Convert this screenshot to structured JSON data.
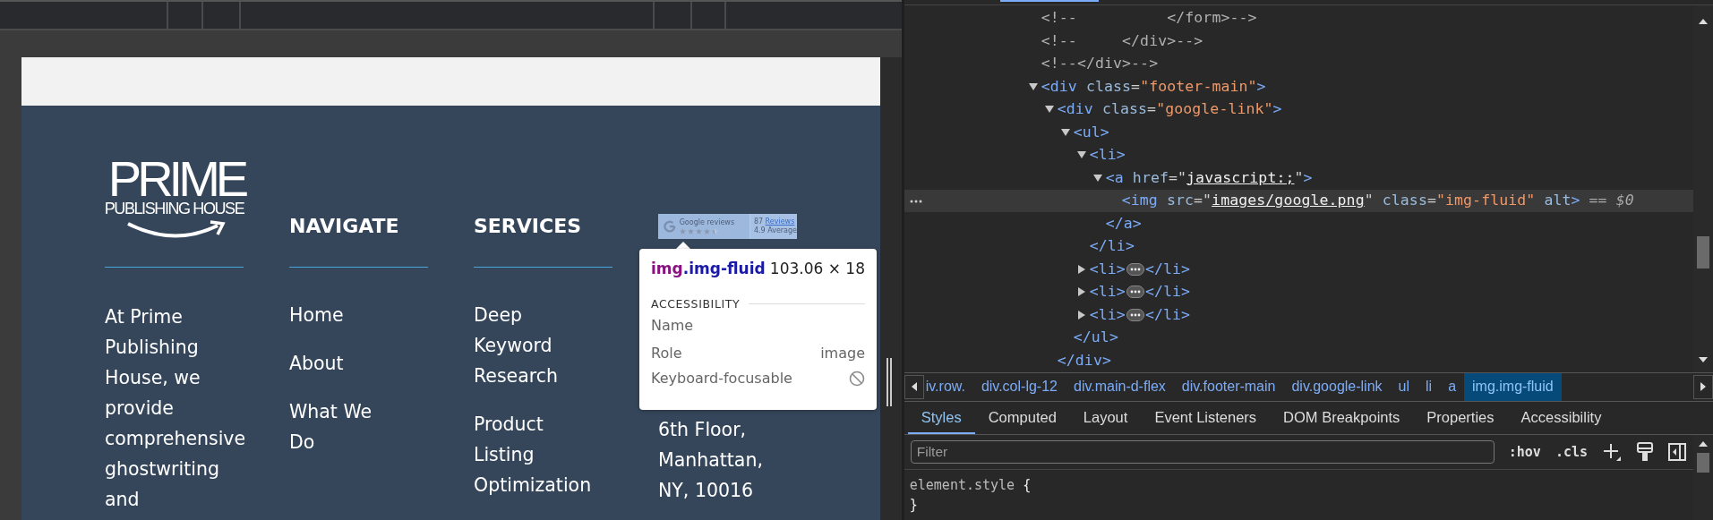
{
  "page": {
    "logo": {
      "title": "PRIME",
      "subtitle": "PUBLISHING HOUSE"
    },
    "about": {
      "lines": [
        "At Prime",
        "Publishing",
        "House, we",
        "provide",
        "comprehensive",
        "ghostwriting",
        "and"
      ]
    },
    "navigate": {
      "heading": "NAVIGATE",
      "links": [
        {
          "lines": [
            "Home"
          ]
        },
        {
          "lines": [
            "About"
          ]
        },
        {
          "lines": [
            "What We",
            "Do"
          ]
        }
      ]
    },
    "services": {
      "heading": "SERVICES",
      "links": [
        {
          "lines": [
            "Deep",
            "Keyword",
            "Research"
          ]
        },
        {
          "lines": [
            "Product",
            "Listing",
            "Optimization"
          ]
        }
      ]
    },
    "reviews_badge": {
      "label": "Google reviews",
      "stars": 4.5,
      "count": "87",
      "count_label": "Reviews",
      "rating": "4.9",
      "rating_label": "Average"
    },
    "address": {
      "lines": [
        "6th Floor,",
        "Manhattan,",
        "NY, 10016"
      ]
    },
    "tooltip": {
      "tag": "img",
      "class": ".img-fluid",
      "size": "103.06 × 18",
      "section": "ACCESSIBILITY",
      "rows": [
        {
          "label": "Name",
          "kind": "text"
        },
        {
          "label": "Role",
          "kind": "text",
          "value": "image"
        },
        {
          "label": "Keyboard-focusable",
          "kind": "blocked"
        }
      ]
    }
  },
  "tree": {
    "nodes": [
      {
        "selected": false,
        "open": [
          {
            "text": "<!--          </form>-->",
            "kind": "comment"
          }
        ]
      },
      {
        "selected": false,
        "open": [
          {
            "text": "<!--     </div>-->",
            "kind": "comment"
          }
        ]
      },
      {
        "selected": false,
        "open": [
          {
            "text": "<!--</div>-->",
            "kind": "comment"
          }
        ]
      },
      {
        "selected": false,
        "expanded": true,
        "open": [
          {
            "text": "<div",
            "kind": "tag"
          },
          {
            "text": " class",
            "kind": "attr"
          },
          {
            "text": "=",
            "kind": "punct"
          },
          {
            "text": "\"footer-main\"",
            "kind": "value"
          },
          {
            "text": ">",
            "kind": "tag"
          }
        ],
        "children": [
          {
            "selected": false,
            "expanded": true,
            "open": [
              {
                "text": "<div",
                "kind": "tag"
              },
              {
                "text": " class",
                "kind": "attr"
              },
              {
                "text": "=",
                "kind": "punct"
              },
              {
                "text": "\"google-link\"",
                "kind": "value"
              },
              {
                "text": ">",
                "kind": "tag"
              }
            ],
            "close": [
              {
                "text": "</div>",
                "kind": "tag"
              }
            ],
            "children": [
              {
                "selected": false,
                "expanded": true,
                "open": [
                  {
                    "text": "<ul>",
                    "kind": "tag"
                  }
                ],
                "close": [
                  {
                    "text": "</ul>",
                    "kind": "tag"
                  }
                ],
                "children": [
                  {
                    "selected": false,
                    "expanded": true,
                    "open": [
                      {
                        "text": "<li>",
                        "kind": "tag"
                      }
                    ],
                    "close": [
                      {
                        "text": "</li>",
                        "kind": "tag"
                      }
                    ],
                    "children": [
                      {
                        "selected": false,
                        "expanded": true,
                        "open": [
                          {
                            "text": "<a",
                            "kind": "tag"
                          },
                          {
                            "text": " href",
                            "kind": "attr"
                          },
                          {
                            "text": "=\"",
                            "kind": "punct"
                          },
                          {
                            "text": "javascript:;",
                            "kind": "link"
                          },
                          {
                            "text": "\"",
                            "kind": "punct"
                          },
                          {
                            "text": ">",
                            "kind": "tag"
                          }
                        ],
                        "close": [
                          {
                            "text": "</a>",
                            "kind": "tag"
                          }
                        ],
                        "children": [
                          {
                            "selected": true,
                            "open": [
                              {
                                "text": "<img",
                                "kind": "tag"
                              },
                              {
                                "text": " src",
                                "kind": "attr"
                              },
                              {
                                "text": "=\"",
                                "kind": "punct"
                              },
                              {
                                "text": "images/google.png",
                                "kind": "link"
                              },
                              {
                                "text": "\"",
                                "kind": "punct"
                              },
                              {
                                "text": " class",
                                "kind": "attr"
                              },
                              {
                                "text": "=",
                                "kind": "punct"
                              },
                              {
                                "text": "\"img-fluid\"",
                                "kind": "value"
                              },
                              {
                                "text": " alt",
                                "kind": "attr"
                              },
                              {
                                "text": ">",
                                "kind": "tag"
                              },
                              {
                                "text": " == ",
                                "kind": "ref"
                              },
                              {
                                "text": "$0",
                                "kind": "refvar"
                              }
                            ]
                          }
                        ]
                      }
                    ]
                  },
                  {
                    "selected": false,
                    "expanded": false,
                    "open": [
                      {
                        "text": "<li>",
                        "kind": "tag"
                      }
                    ],
                    "close": [
                      {
                        "text": "</li>",
                        "kind": "tag"
                      }
                    ]
                  },
                  {
                    "selected": false,
                    "expanded": false,
                    "open": [
                      {
                        "text": "<li>",
                        "kind": "tag"
                      }
                    ],
                    "close": [
                      {
                        "text": "</li>",
                        "kind": "tag"
                      }
                    ]
                  },
                  {
                    "selected": false,
                    "expanded": false,
                    "open": [
                      {
                        "text": "<li>",
                        "kind": "tag"
                      }
                    ],
                    "close": [
                      {
                        "text": "</li>",
                        "kind": "tag"
                      }
                    ]
                  }
                ]
              }
            ]
          }
        ]
      }
    ]
  },
  "breadcrumbs": [
    {
      "label": "iv.row.",
      "selected": false
    },
    {
      "label": "div.col-lg-12",
      "selected": false
    },
    {
      "label": "div.main-d-flex",
      "selected": false
    },
    {
      "label": "div.footer-main",
      "selected": false
    },
    {
      "label": "div.google-link",
      "selected": false
    },
    {
      "label": "ul",
      "selected": false
    },
    {
      "label": "li",
      "selected": false
    },
    {
      "label": "a",
      "selected": false
    },
    {
      "label": "img.img-fluid",
      "selected": true
    }
  ],
  "tabs": [
    {
      "label": "Styles",
      "selected": true
    },
    {
      "label": "Computed",
      "selected": false
    },
    {
      "label": "Layout",
      "selected": false
    },
    {
      "label": "Event Listeners",
      "selected": false
    },
    {
      "label": "DOM Breakpoints",
      "selected": false
    },
    {
      "label": "Properties",
      "selected": false
    },
    {
      "label": "Accessibility",
      "selected": false
    }
  ],
  "styles": {
    "filter": {
      "placeholder": "Filter"
    },
    "hov": ":hov",
    "cls": ".cls",
    "rule_open": "element.style",
    "brace_open": "{",
    "brace_close": "}"
  }
}
